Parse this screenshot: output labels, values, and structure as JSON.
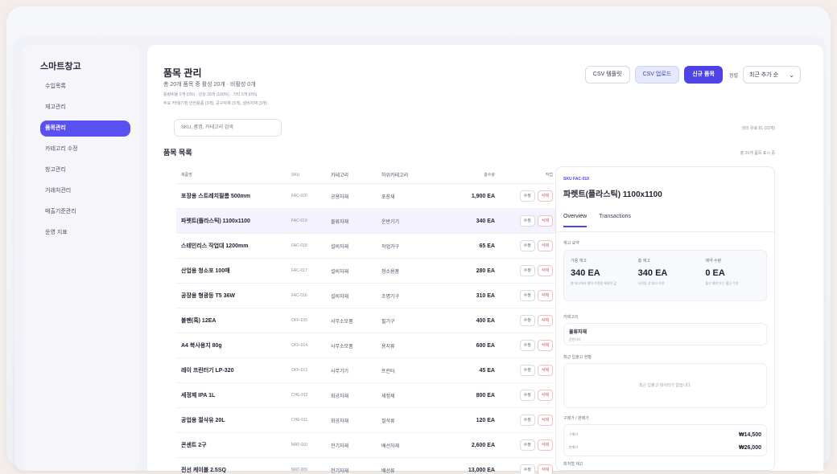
{
  "sidebar": {
    "brand": "스마트창고",
    "items": [
      {
        "label": "수입목록",
        "active": false
      },
      {
        "label": "재고관리",
        "active": false
      },
      {
        "label": "품목관리",
        "active": true
      },
      {
        "label": "카테고리 수정",
        "active": false
      },
      {
        "label": "창고관리",
        "active": false
      },
      {
        "label": "거래처관리",
        "active": false
      },
      {
        "label": "매출기준관리",
        "active": false
      },
      {
        "label": "운영 지표",
        "active": false
      }
    ]
  },
  "header": {
    "title": "품목 관리",
    "summary": "총 20개 품목 중 활성 20개 · 비활성 0개",
    "summary_detail": "용량비율 0개 (0%) · 성상 20개 (100%) · 기타 0개 (0%)",
    "summary_detail2": "주요 카테(7개) 안전용품 (3개), 공구자재 (3개), 설비자재 (3개)"
  },
  "toolbar": {
    "csv_template": "CSV 템플릿",
    "csv_import": "CSV 업로드",
    "new_item": "신규 품목",
    "sort_label": "정렬",
    "sort_value": "최근 추가 순",
    "sort_chevron": "chevron-down-icon"
  },
  "search": {
    "placeholder": "SKU, 품명, 카테고리 검색"
  },
  "selection_status": "생의 유료 81 (20개)",
  "list": {
    "title": "품목 목록",
    "count": "총 20개 품목 표시 중",
    "columns": {
      "name": "제품명",
      "sku": "SKU",
      "category": "카테고리",
      "subcategory": "하위카테고리",
      "quantity": "총수량",
      "actions": "작업"
    },
    "edit_label": "수정",
    "delete_label": "삭제",
    "rows": [
      {
        "name": "포장용 스트레치필름 500mm",
        "sku": "FAC-020",
        "category": "공용자재",
        "subcategory": "포장재",
        "quantity": "1,900 EA",
        "selected": false
      },
      {
        "name": "파렛트(플라스틱) 1100x1100",
        "sku": "FAC-019",
        "category": "물류자재",
        "subcategory": "운반기기",
        "quantity": "340 EA",
        "selected": true
      },
      {
        "name": "스테인리스 작업대 1200mm",
        "sku": "FAC-018",
        "category": "설비자재",
        "subcategory": "작업가구",
        "quantity": "65 EA",
        "selected": false
      },
      {
        "name": "산업용 청소포 100매",
        "sku": "FAC-017",
        "category": "설비자재",
        "subcategory": "청소용품",
        "quantity": "280 EA",
        "selected": false
      },
      {
        "name": "공장용 형광등 T5 36W",
        "sku": "FAC-016",
        "category": "설비자재",
        "subcategory": "조명기구",
        "quantity": "310 EA",
        "selected": false
      },
      {
        "name": "볼펜(흑) 12EA",
        "sku": "OFF-015",
        "category": "사무소모품",
        "subcategory": "필기구",
        "quantity": "400 EA",
        "selected": false
      },
      {
        "name": "A4 복사용지 80g",
        "sku": "OFF-014",
        "category": "사무소모품",
        "subcategory": "용지류",
        "quantity": "600 EA",
        "selected": false
      },
      {
        "name": "레이 프린터기 LP-320",
        "sku": "OFF-013",
        "category": "사무기기",
        "subcategory": "프린터",
        "quantity": "45 EA",
        "selected": false
      },
      {
        "name": "세정제 IPA 1L",
        "sku": "CHE-012",
        "category": "화공자재",
        "subcategory": "세정제",
        "quantity": "800 EA",
        "selected": false
      },
      {
        "name": "공업용 절삭유 20L",
        "sku": "CHE-011",
        "category": "화공자재",
        "subcategory": "절삭류",
        "quantity": "120 EA",
        "selected": false
      },
      {
        "name": "콘센트 2구",
        "sku": "MAT-010",
        "category": "전기자재",
        "subcategory": "배선자재",
        "quantity": "2,600 EA",
        "selected": false
      },
      {
        "name": "전선 케이블 2.5SQ",
        "sku": "MAT-009",
        "category": "전기자재",
        "subcategory": "배선류",
        "quantity": "13,000 EA",
        "selected": false
      }
    ]
  },
  "detail": {
    "sku": "SKU FAC-019",
    "name": "파렛트(플라스틱) 1100x1100",
    "tabs": [
      {
        "label": "Overview",
        "active": true
      },
      {
        "label": "Transactions",
        "active": false
      }
    ],
    "stock_label": "재고 요약",
    "stocks": [
      {
        "label": "가용 재고",
        "value": "340 EA",
        "sub": "총 재고에서 예약 수량을 제외한 값"
      },
      {
        "label": "총 재고",
        "value": "340 EA",
        "sub": "사전등 상 재고 수량"
      },
      {
        "label": "예약 수량",
        "value": "0 EA",
        "sub": "출고 예약 또는 홀딩 수량"
      }
    ],
    "category_label": "카테고리",
    "category": "물류자재",
    "subcategory": "운반기기",
    "history_label": "최근 입출고 현황",
    "history_empty": "최근 입출고 데이터가 없습니다.",
    "price_label": "구매가 / 판매가",
    "purchase_label": "구매가",
    "purchase_value": "₩14,500",
    "sale_label": "판매가",
    "sale_value": "₩26,000",
    "min_stock_label": "최저형 재고"
  }
}
